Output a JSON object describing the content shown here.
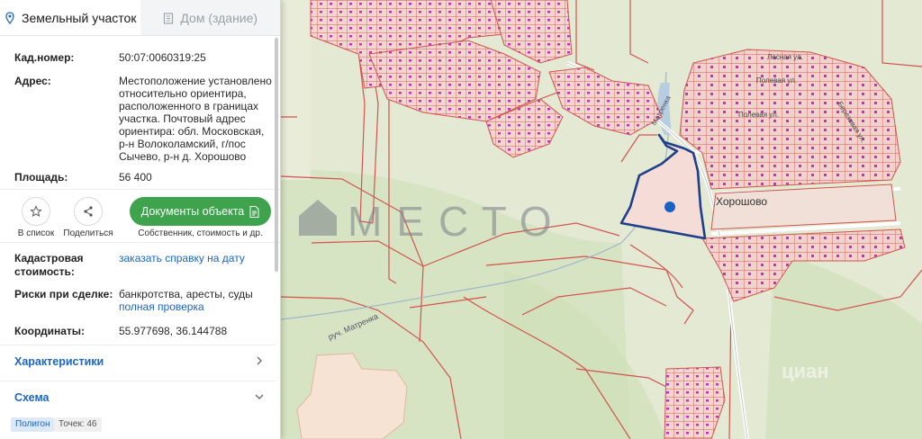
{
  "tabs": [
    {
      "label": "Земельный участок",
      "icon": "map-pin-icon",
      "active": true
    },
    {
      "label": "Дом (здание)",
      "icon": "building-icon",
      "active": false
    }
  ],
  "fields": {
    "cad_label": "Кад.номер:",
    "cad_value": "50:07:0060319:25",
    "address_label": "Адрес:",
    "address_value": "Местоположение установлено относительно ориентира, расположенного в границах участка. Почтовый адрес ориентира: обл. Московская, р-н Волоколамский, г/пос Сычево, р-н д. Хорошово",
    "area_label": "Площадь:",
    "area_value": "56 400"
  },
  "actions": {
    "favorite_label": "В список",
    "share_label": "Поделиться",
    "docs_button": "Документы объекта",
    "docs_sub": "Собственник, стоимость и др."
  },
  "details": {
    "cad_cost_label": "Кадастровая стоимость:",
    "cad_cost_link": "заказать справку на дату",
    "risks_label": "Риски при сделке:",
    "risks_value": "банкротства, аресты, суды",
    "risks_link": "полная проверка",
    "coords_label": "Координаты:",
    "coords_value": "55.977698, 36.144788"
  },
  "sections": {
    "characteristics": "Характеристики",
    "scheme": "Схема"
  },
  "chips": {
    "polygon": "Полигон",
    "points": "Точек: 46"
  },
  "map": {
    "watermark": "МЕСТО",
    "village_label": "Хорошово",
    "stream_label": "руч. Матренка",
    "stream_label2": "Матренка",
    "street_1": "Лесная ул.",
    "street_2": "Полевая ул.",
    "street_3": "Березовая ул.",
    "street_4": "Полевая ул.",
    "corner_mark": "циан"
  },
  "colors": {
    "accent": "#1a66c6",
    "button_green": "#3fa34d",
    "parcel_outline": "#1e3f8a",
    "parcel_fill": "#f6dcd6",
    "cadastral_line": "#d2544f",
    "building": "#c733b8"
  }
}
